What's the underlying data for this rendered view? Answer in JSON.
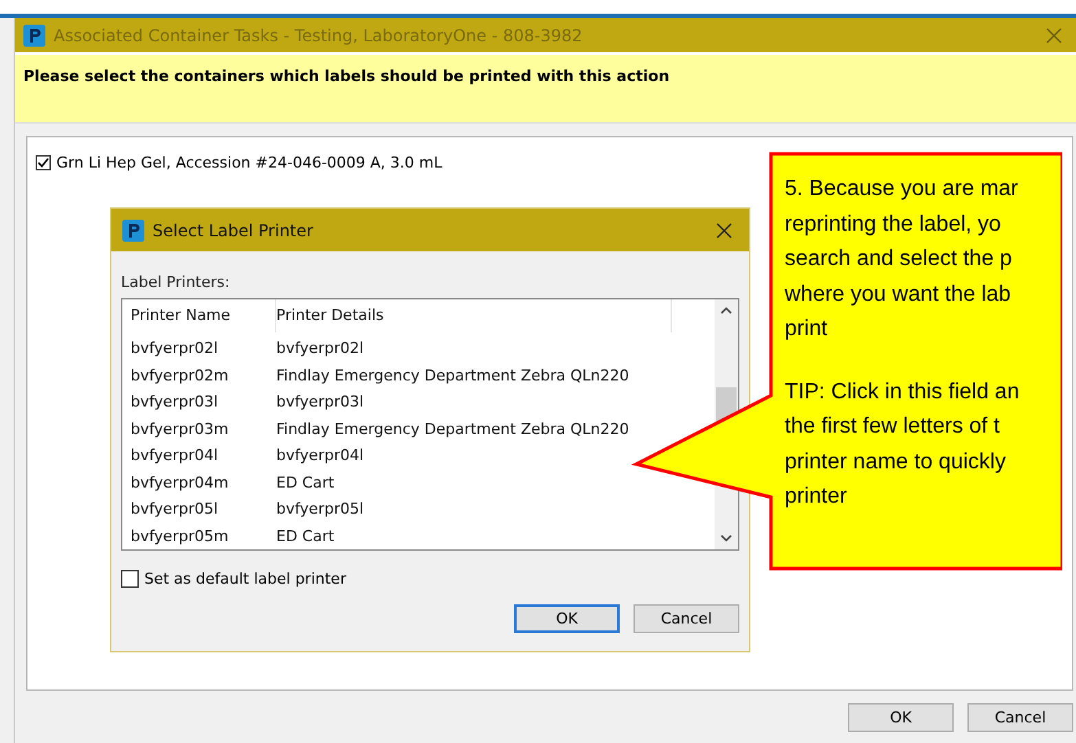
{
  "window": {
    "title": "Associated Container Tasks - Testing, LaboratoryOne - 808-3982",
    "instruction": "Please select the containers which labels should be printed with this action"
  },
  "containers": [
    {
      "label": "Grn Li Hep Gel, Accession #24-046-0009 A, 3.0 mL",
      "checked": true
    }
  ],
  "buttons": [
    {
      "label": "OK"
    },
    {
      "label": "Cancel"
    }
  ],
  "dialog": {
    "title": "Select Label Printer",
    "list_label": "Label Printers:",
    "columns": [
      "Printer Name",
      "Printer Details"
    ],
    "rows": [
      {
        "name": "bvfyerpr02l",
        "details": "bvfyerpr02l"
      },
      {
        "name": "bvfyerpr02m",
        "details": "Findlay Emergency Department Zebra QLn220"
      },
      {
        "name": "bvfyerpr03l",
        "details": "bvfyerpr03l"
      },
      {
        "name": "bvfyerpr03m",
        "details": "Findlay Emergency Department Zebra QLn220"
      },
      {
        "name": "bvfyerpr04l",
        "details": "bvfyerpr04l"
      },
      {
        "name": "bvfyerpr04m",
        "details": "ED Cart"
      },
      {
        "name": "bvfyerpr05l",
        "details": "bvfyerpr05l"
      },
      {
        "name": "bvfyerpr05m",
        "details": "ED Cart"
      }
    ],
    "default_option": {
      "label": "Set as default label printer",
      "checked": false
    },
    "buttons": [
      {
        "label": "OK",
        "kind": "default"
      },
      {
        "label": "Cancel",
        "kind": "normal"
      }
    ]
  },
  "callout": {
    "paragraphs": [
      {
        "lines": [
          "5. Because you are mar",
          "reprinting the label, yo",
          "search and select the p",
          "where you want the lab",
          "print"
        ]
      },
      {
        "lines": [
          "TIP: Click in this field an",
          "the first few letters of t",
          "printer name to quickly",
          "printer"
        ]
      }
    ]
  }
}
